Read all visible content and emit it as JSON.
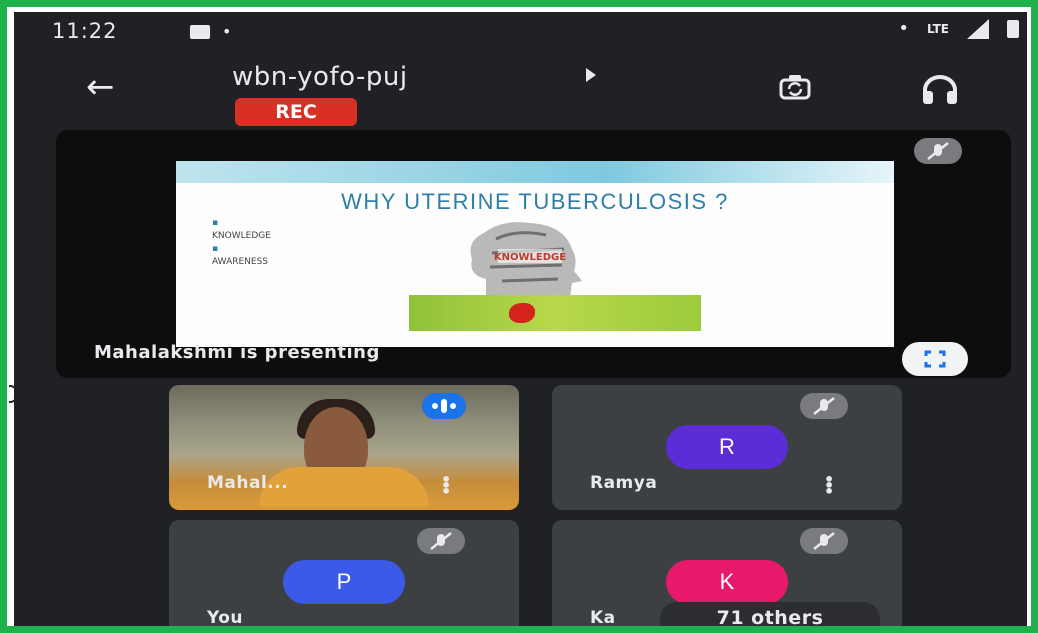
{
  "status_bar": {
    "time": "11:22",
    "dot": "•",
    "lte": "LTE"
  },
  "header": {
    "back_icon": "arrow-left-icon",
    "meeting_code": "wbn-yofo-puj",
    "rec_badge": "REC",
    "switch_camera_icon": "switch-camera-icon",
    "audio_icon": "headset-icon"
  },
  "presentation": {
    "slide_title": "WHY UTERINE TUBERCULOSIS ?",
    "slide_bullets": [
      "KNOWLEDGE",
      "AWARENESS"
    ],
    "slide_center_label": "KNOWLEDGE",
    "presenter_label": "Mahalakshmi is presenting",
    "mic_status_icon": "mic-off-icon",
    "fullscreen_icon": "fullscreen-icon"
  },
  "participants": [
    {
      "name": "Mahal...",
      "video": true,
      "speaking_icon": "speaking-indicator-icon"
    },
    {
      "name": "Ramya",
      "initial": "R",
      "avatar_color": "#5c2dd6",
      "muted": true
    },
    {
      "name": "You",
      "initial": "P",
      "avatar_color": "#3b5ae8",
      "muted": true
    },
    {
      "name": "Ka",
      "initial": "K",
      "avatar_color": "#e8196b",
      "muted": true
    }
  ],
  "others_label": "71 others",
  "colors": {
    "frame_border": "#1fb14b",
    "background": "#202124",
    "rec": "#d93025",
    "accent_blue": "#1a73e8"
  }
}
